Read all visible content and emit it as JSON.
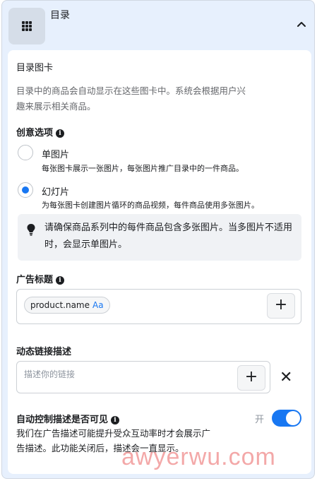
{
  "panel": {
    "title": "目录",
    "icon": "grid-icon",
    "collapse_icon": "chevron-up-icon"
  },
  "catalog_card": {
    "title": "目录图卡",
    "description_line1": "目录中的商品会自动显示在这些图卡中。系统会根据用户兴",
    "description_line2": "趣来展示相关商品。"
  },
  "creative_options": {
    "title": "创意选项",
    "options": [
      {
        "label": "单图片",
        "description": "每张图卡展示一张图片，每张图片推广目录中的一件商品。",
        "selected": false
      },
      {
        "label": "幻灯片",
        "description": "为每张图卡创建图片循环的商品视频，每件商品使用多张图片。",
        "selected": true
      }
    ],
    "notice_icon": "lightbulb-icon",
    "notice_text": "请确保商品系列中的每件商品包含多张图片。当多图片不适用时，会显示单图片。"
  },
  "ad_headline": {
    "title": "广告标题",
    "token_label": "product.name",
    "token_suffix": "Aa",
    "add_label": "+"
  },
  "dynamic_link": {
    "title": "动态链接描述",
    "placeholder": "描述你的链接",
    "add_label": "+",
    "close_label": "✕"
  },
  "auto_control": {
    "title": "自动控制描述是否可见",
    "toggle_label": "开",
    "toggle_on": true,
    "description_line1": "我们在广告描述可能提升受众互动率时才会展示广",
    "description_line2": "告描述。此功能关闭后，描述会一直显示。"
  },
  "watermark": {
    "text": "awyerwu.com"
  },
  "colors": {
    "accent": "#1877f2",
    "panel_bg": "#e7f0fd",
    "watermark": "#f29a9a"
  }
}
